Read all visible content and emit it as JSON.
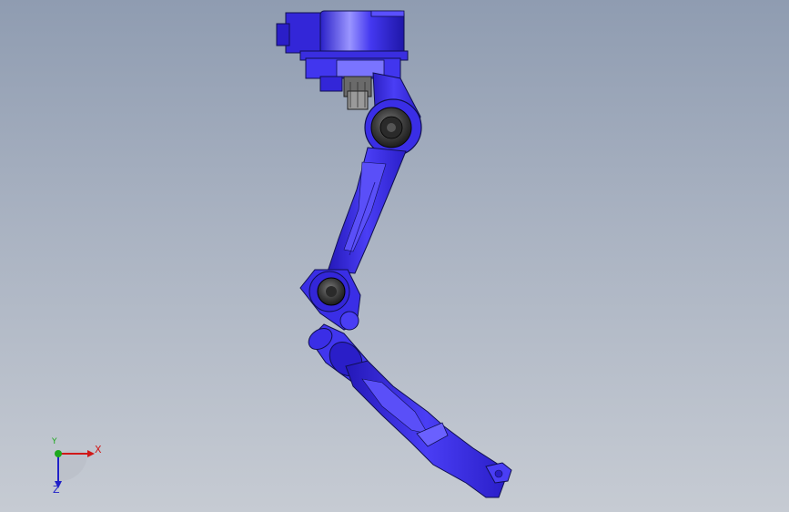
{
  "viewport": {
    "background_top": "#8f9cb1",
    "background_bottom": "#c6cbd3",
    "model_color": "#3a2fe6"
  },
  "model": {
    "name_icon": "robot-arm-model"
  },
  "triad": {
    "x_label": "X",
    "y_label": "Y",
    "z_label": "Z",
    "x_color": "#d01818",
    "y_color": "#1ea81e",
    "z_color": "#2020c8"
  }
}
